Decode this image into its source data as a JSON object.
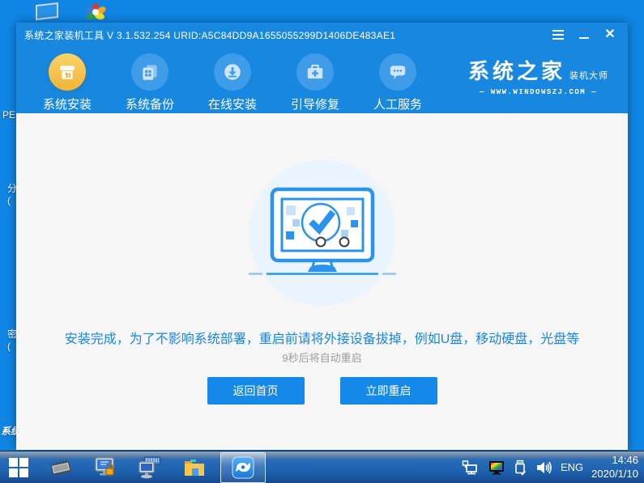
{
  "colors": {
    "desktop_blue": "#0f86e6",
    "window_chrome_blue": "#1787e0",
    "nav_circle_blue": "#3f9ce8",
    "active_gold": "#f3b53a",
    "content_bg": "#f6f6f6",
    "button_blue": "#1489e9",
    "message_blue": "#1787e0",
    "countdown_gray": "#9b9b9b",
    "taskbar_blue": "#1e62b0"
  },
  "desktop": {
    "icons": [
      "computer-shortcut",
      "media-player-shortcut"
    ],
    "occluded_labels": [
      "PE",
      "分",
      "(",
      "密",
      "(",
      "系统"
    ]
  },
  "window": {
    "title": "系统之家装机工具 V 3.1.532.254 URID:A5C84DD9A1655055299D1406DE483AE1",
    "controls": {
      "menu": "menu",
      "minimize": "minimize",
      "close": "close"
    },
    "nav": {
      "items": [
        {
          "label": "系统安装",
          "icon": "install-box-icon",
          "active": true
        },
        {
          "label": "系统备份",
          "icon": "backup-copies-icon",
          "active": false
        },
        {
          "label": "在线安装",
          "icon": "online-download-icon",
          "active": false
        },
        {
          "label": "引导修复",
          "icon": "boot-repair-toolbox-icon",
          "active": false
        },
        {
          "label": "人工服务",
          "icon": "support-chat-icon",
          "active": false
        }
      ]
    },
    "logo": {
      "brand": "系统之家",
      "tagline": "装机大师",
      "url": "WWW.WINDOWSZJ.COM",
      "url_display": "—  WWW.WINDOWSZJ.COM  —"
    },
    "main": {
      "illustration": "monitor-with-checkmark",
      "message": "安装完成，为了不影响系统部署，重启前请将外接设备拔掉，例如U盘，移动硬盘，光盘等",
      "countdown": "9秒后将自动重启",
      "countdown_seconds": 9,
      "buttons": [
        {
          "label": "返回首页"
        },
        {
          "label": "立即重启"
        }
      ]
    }
  },
  "taskbar": {
    "start": "start-button",
    "apps": [
      "memory-chip-tool",
      "partition-lock-tool",
      "onscreen-keyboard-tool",
      "file-explorer",
      "zhuangji-app-active"
    ],
    "tray": {
      "icons": [
        "network-tray-icon",
        "display-color-tray-icon",
        "usb-tray-icon",
        "volume-tray-icon"
      ],
      "language": "ENG",
      "time": "14:46",
      "date": "2020/1/10"
    }
  }
}
